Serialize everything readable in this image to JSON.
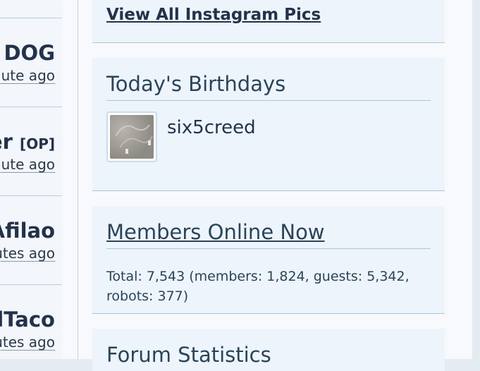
{
  "recent_posts": [
    {
      "name": "D DOG",
      "op": "",
      "time": "nute ago"
    },
    {
      "name": "er",
      "op": "[OP]",
      "time": "nute ago"
    },
    {
      "name": "Afilao",
      "op": "",
      "time": "utes ago"
    },
    {
      "name": "dTaco",
      "op": "",
      "time": "utes ago"
    }
  ],
  "instagram": {
    "link_label": "View All Instagram Pics"
  },
  "birthdays": {
    "title": "Today's Birthdays",
    "member": "six5creed"
  },
  "members_online": {
    "title": "Members Online Now",
    "summary": "Total: 7,543 (members: 1,824, guests: 5,342, robots: 377)"
  },
  "forum_stats": {
    "title": "Forum Statistics"
  },
  "colors": {
    "accent": "#23324a",
    "panel_bg": "#edf4fb",
    "divider": "#a9c8d9"
  }
}
